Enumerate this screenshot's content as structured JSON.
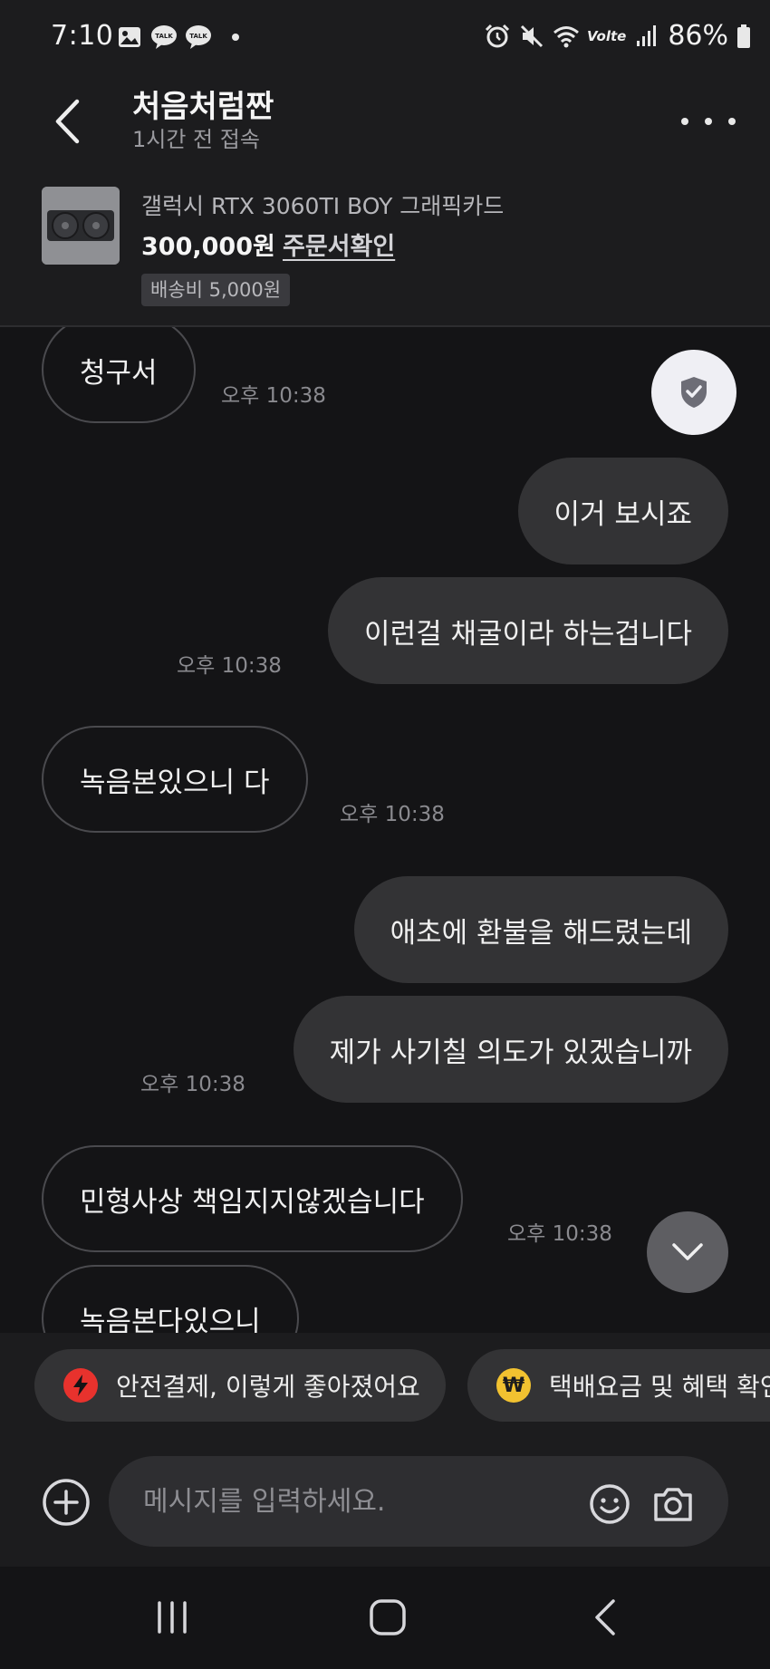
{
  "status_bar": {
    "time": "7:10",
    "talk_badge_1": "TALK",
    "talk_badge_2": "TALK",
    "volte_label": "Volte",
    "battery_percent": "86%"
  },
  "header": {
    "title": "처음처럼짠",
    "subtitle": "1시간 전 접속"
  },
  "product": {
    "name": "갤럭시 RTX 3060TI BOY 그래픽카드",
    "price": "300,000원",
    "order_link": "주문서확인",
    "shipping": "배송비 5,000원"
  },
  "messages": [
    {
      "side": "in",
      "text": "청구서"
    },
    {
      "side": "in",
      "text": "오후 10:38",
      "kind": "timestamp"
    },
    {
      "side": "out",
      "text": "이거 보시죠"
    },
    {
      "side": "out",
      "text": "이런걸 채굴이라 하는겁니다"
    },
    {
      "side": "out",
      "text": "오후 10:38",
      "kind": "timestamp"
    },
    {
      "side": "in",
      "text": "녹음본있으니 다"
    },
    {
      "side": "in",
      "text": "오후 10:38",
      "kind": "timestamp"
    },
    {
      "side": "out",
      "text": "애초에 환불을 해드렸는데"
    },
    {
      "side": "out",
      "text": "제가 사기칠 의도가 있겠습니까"
    },
    {
      "side": "out",
      "text": "오후 10:38",
      "kind": "timestamp"
    },
    {
      "side": "in",
      "text": "민형사상 책임지지않겠습니다"
    },
    {
      "side": "in",
      "text": "오후 10:38",
      "kind": "timestamp"
    },
    {
      "side": "in",
      "text": "녹음본다있으니"
    }
  ],
  "chips": [
    {
      "label": "안전결제, 이렇게 좋아졌어요",
      "icon": "lightning-icon",
      "color": "#e8322d"
    },
    {
      "label": "택배요금 및 혜택 확인",
      "icon": "won-coin-icon",
      "color": "#f2c230",
      "icon_glyph": "₩"
    }
  ],
  "input": {
    "placeholder": "메시지를 입력하세요."
  },
  "colors": {
    "background": "#141416",
    "surface": "#1c1c1e",
    "outgoing_bubble": "#333335",
    "incoming_border": "#4a4a4e",
    "shield_button": "#efeff4"
  }
}
